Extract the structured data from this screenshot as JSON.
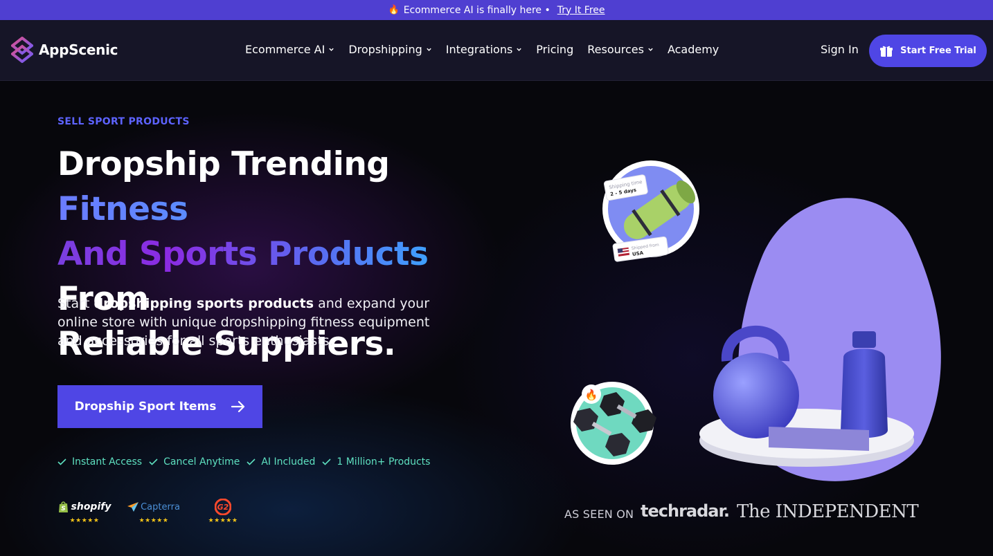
{
  "announcement": {
    "icon": "fire-icon",
    "text": "Ecommerce AI is finally here •",
    "link": "Try It Free"
  },
  "nav": {
    "brand": "AppScenic",
    "menu": [
      {
        "label": "Ecommerce AI",
        "dropdown": true
      },
      {
        "label": "Dropshipping",
        "dropdown": true
      },
      {
        "label": "Integrations",
        "dropdown": true
      },
      {
        "label": "Pricing",
        "dropdown": false
      },
      {
        "label": "Resources",
        "dropdown": true
      },
      {
        "label": "Academy",
        "dropdown": false
      }
    ],
    "sign_in": "Sign In",
    "cta": "Start Free Trial"
  },
  "hero": {
    "eyebrow": "SELL SPORT PRODUCTS",
    "headline": {
      "part1": "Dropship Trending ",
      "part2": "Fitness",
      "part3": "And Sports Products",
      "part4": " From",
      "part5": "Reliable Suppliers."
    },
    "desc": {
      "pre": "Start ",
      "bold": "dropshipping sports products",
      "post": " and expand your online store with unique dropshipping fitness equipment and accessories for all sports enthusiasts."
    },
    "cta": "Dropship Sport Items",
    "features": [
      "Instant Access",
      "Cancel Anytime",
      "AI Included",
      "1 Million+ Products"
    ],
    "badges": [
      {
        "name": "shopify",
        "stars": "★★★★★"
      },
      {
        "name": "Capterra",
        "stars": "★★★★★"
      },
      {
        "name": "G2",
        "stars": "★★★★★"
      }
    ],
    "seen_on": "AS SEEN ON",
    "press": [
      "techradar.",
      "The INDEPENDENT"
    ],
    "tags": {
      "shipping_time_label": "Shipping time",
      "shipping_time_value": "2 - 5 days",
      "shipped_from_label": "Shipped from",
      "shipped_from_value": "USA"
    }
  },
  "colors": {
    "accent": "#4f46e5",
    "announce": "#4f3fd1",
    "feature": "#5ee0c0",
    "eyebrow": "#5d63ff"
  }
}
